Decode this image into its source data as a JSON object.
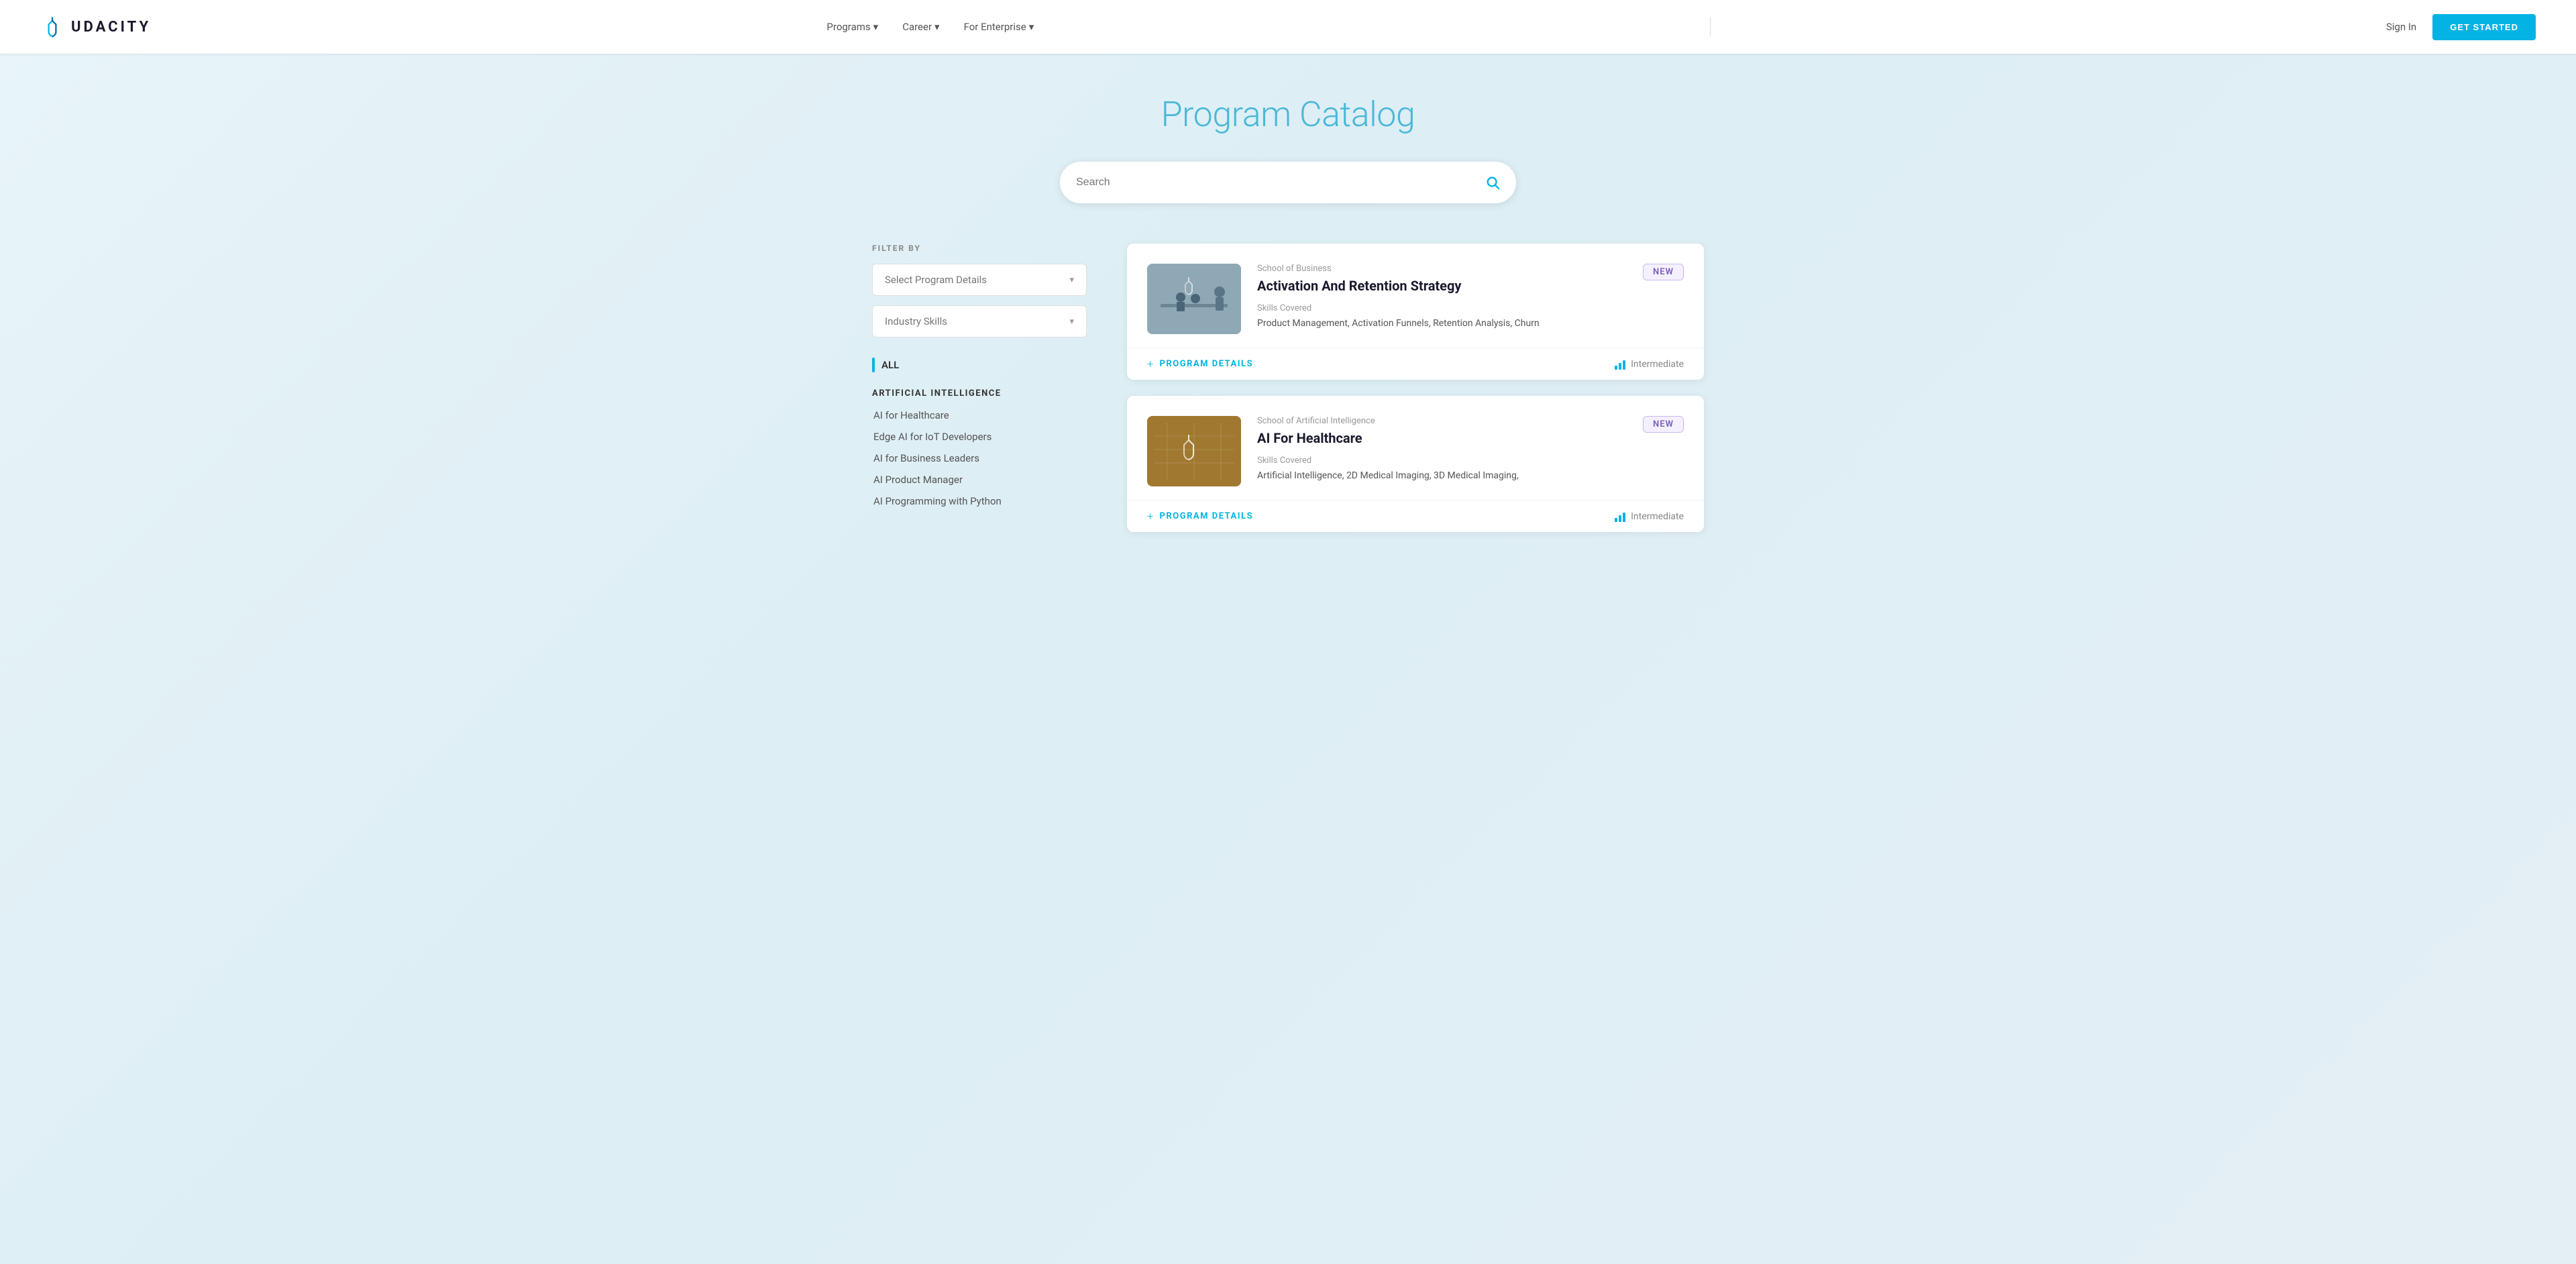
{
  "header": {
    "logo_text": "UDACITY",
    "nav_items": [
      {
        "label": "Programs",
        "has_dropdown": true
      },
      {
        "label": "Career",
        "has_dropdown": true
      },
      {
        "label": "For Enterprise",
        "has_dropdown": true
      }
    ],
    "sign_in_label": "Sign In",
    "get_started_label": "GET STARTED"
  },
  "page": {
    "title": "Program Catalog",
    "search_placeholder": "Search"
  },
  "sidebar": {
    "filter_by_label": "FILTER BY",
    "dropdown1_placeholder": "Select Program Details",
    "dropdown2_placeholder": "Industry Skills",
    "all_label": "ALL",
    "categories": [
      {
        "title": "ARTIFICIAL INTELLIGENCE",
        "items": [
          "AI for Healthcare",
          "Edge AI for IoT Developers",
          "AI for Business Leaders",
          "AI Product Manager",
          "AI Programming with Python"
        ]
      }
    ]
  },
  "cards": [
    {
      "school": "School of Business",
      "title": "Activation And Retention Strategy",
      "badge": "NEW",
      "skills_label": "Skills Covered",
      "skills": "Product Management, Activation Funnels, Retention Analysis, Churn",
      "level": "Intermediate",
      "program_details_label": "PROGRAM DETAILS",
      "thumb_type": "business"
    },
    {
      "school": "School of Artificial Intelligence",
      "title": "AI For Healthcare",
      "badge": "NEW",
      "skills_label": "Skills Covered",
      "skills": "Artificial Intelligence, 2D Medical Imaging, 3D Medical Imaging,",
      "level": "Intermediate",
      "program_details_label": "PROGRAM DETAILS",
      "thumb_type": "ai"
    }
  ]
}
